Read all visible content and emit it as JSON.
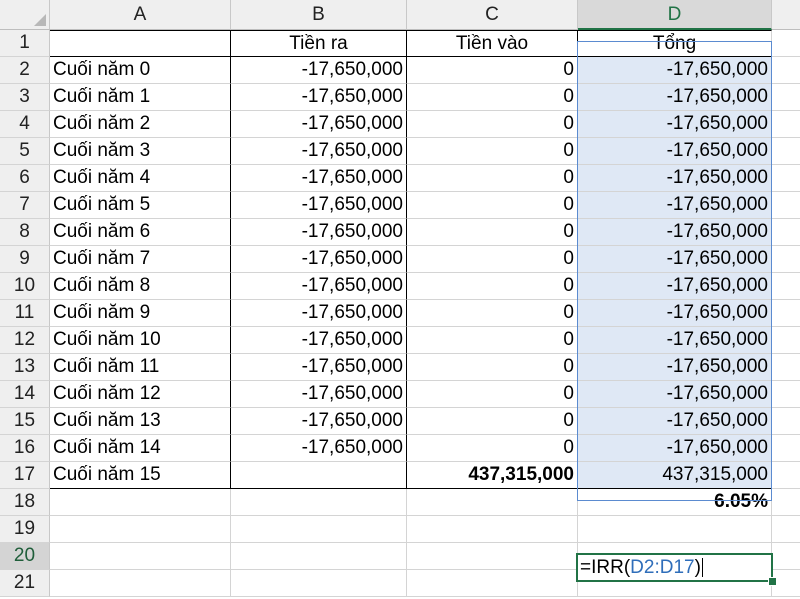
{
  "columns": [
    "A",
    "B",
    "C",
    "D"
  ],
  "header_row": {
    "row": "1",
    "a": "",
    "b": "Tiền ra",
    "c": "Tiền vào",
    "d": "Tổng"
  },
  "rows": [
    {
      "row": "2",
      "a": "Cuối năm 0",
      "b": "-17,650,000",
      "c": "0",
      "d": "-17,650,000"
    },
    {
      "row": "3",
      "a": "Cuối năm 1",
      "b": "-17,650,000",
      "c": "0",
      "d": "-17,650,000"
    },
    {
      "row": "4",
      "a": "Cuối năm 2",
      "b": "-17,650,000",
      "c": "0",
      "d": "-17,650,000"
    },
    {
      "row": "5",
      "a": "Cuối năm 3",
      "b": "-17,650,000",
      "c": "0",
      "d": "-17,650,000"
    },
    {
      "row": "6",
      "a": "Cuối năm 4",
      "b": "-17,650,000",
      "c": "0",
      "d": "-17,650,000"
    },
    {
      "row": "7",
      "a": "Cuối năm 5",
      "b": "-17,650,000",
      "c": "0",
      "d": "-17,650,000"
    },
    {
      "row": "8",
      "a": "Cuối năm 6",
      "b": "-17,650,000",
      "c": "0",
      "d": "-17,650,000"
    },
    {
      "row": "9",
      "a": "Cuối năm 7",
      "b": "-17,650,000",
      "c": "0",
      "d": "-17,650,000"
    },
    {
      "row": "10",
      "a": "Cuối năm 8",
      "b": "-17,650,000",
      "c": "0",
      "d": "-17,650,000"
    },
    {
      "row": "11",
      "a": "Cuối năm 9",
      "b": "-17,650,000",
      "c": "0",
      "d": "-17,650,000"
    },
    {
      "row": "12",
      "a": "Cuối năm 10",
      "b": "-17,650,000",
      "c": "0",
      "d": "-17,650,000"
    },
    {
      "row": "13",
      "a": "Cuối năm 11",
      "b": "-17,650,000",
      "c": "0",
      "d": "-17,650,000"
    },
    {
      "row": "14",
      "a": "Cuối năm 12",
      "b": "-17,650,000",
      "c": "0",
      "d": "-17,650,000"
    },
    {
      "row": "15",
      "a": "Cuối năm 13",
      "b": "-17,650,000",
      "c": "0",
      "d": "-17,650,000"
    },
    {
      "row": "16",
      "a": "Cuối năm 14",
      "b": "-17,650,000",
      "c": "0",
      "d": "-17,650,000"
    },
    {
      "row": "17",
      "a": "Cuối năm 15",
      "b": "",
      "c": "437,315,000",
      "d": "437,315,000"
    }
  ],
  "row18": {
    "row": "18",
    "d": "6.05%"
  },
  "row19": {
    "row": "19"
  },
  "row20": {
    "row": "20",
    "formula_prefix": "=IRR(",
    "formula_ref": "D2:D17",
    "formula_suffix": ")"
  },
  "row21": {
    "row": "21"
  },
  "colors": {
    "selection_fill": "#dfe8f5",
    "selection_border": "#5b8bd0",
    "active_green": "#217346",
    "ref_blue": "#2f6eba"
  }
}
